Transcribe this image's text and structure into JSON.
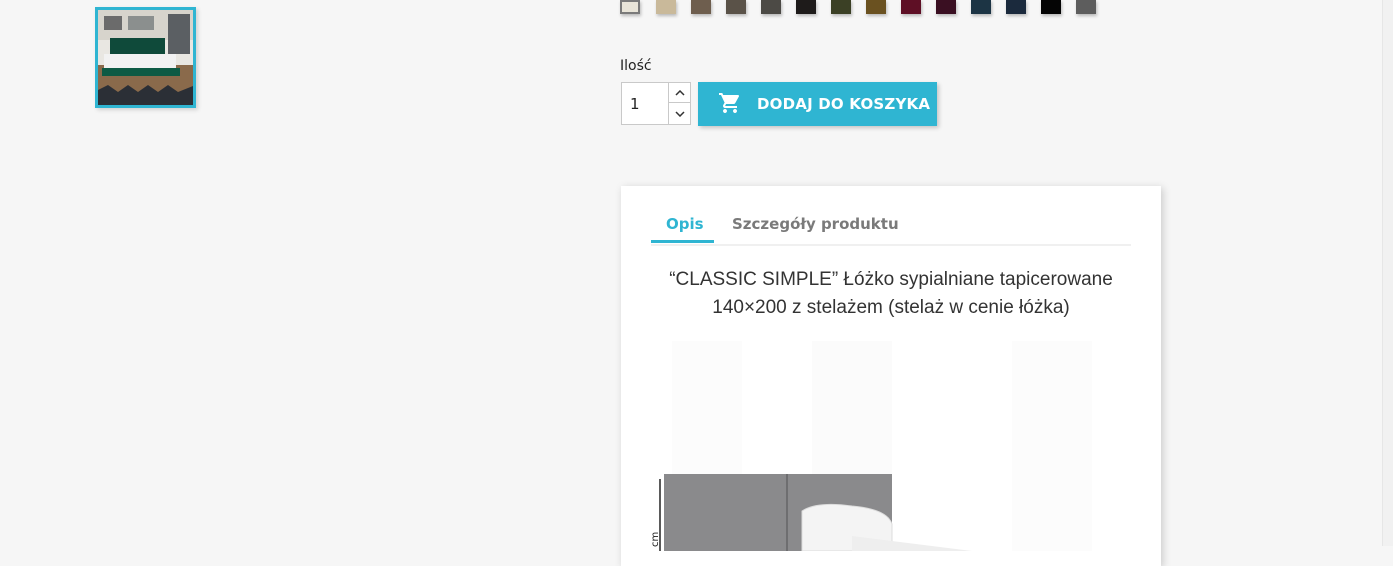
{
  "swatch_colors": [
    "#e8e4d8",
    "#c9b99a",
    "#6e5e4e",
    "#5a5248",
    "#4c4a45",
    "#1e1b1a",
    "#3b4025",
    "#6a5120",
    "#5e0f25",
    "#3a0f22",
    "#1c3444",
    "#1b2a3d",
    "#050505",
    "#5d5d5d"
  ],
  "quantity": {
    "label": "Ilość",
    "value": "1"
  },
  "add_to_cart": {
    "label": "DODAJ DO KOSZYKA",
    "icon": "cart-icon"
  },
  "tabs": [
    {
      "label": "Opis"
    },
    {
      "label": "Szczegóły produktu"
    }
  ],
  "description": {
    "title_line1": "“CLASSIC SIMPLE” Łóżko sypialniane tapicerowane",
    "title_line2": "140×200 z stelażem (stelaż w cenie łóżka)",
    "dimension_unit": "cm"
  },
  "accent_color": "#2fb5d2"
}
